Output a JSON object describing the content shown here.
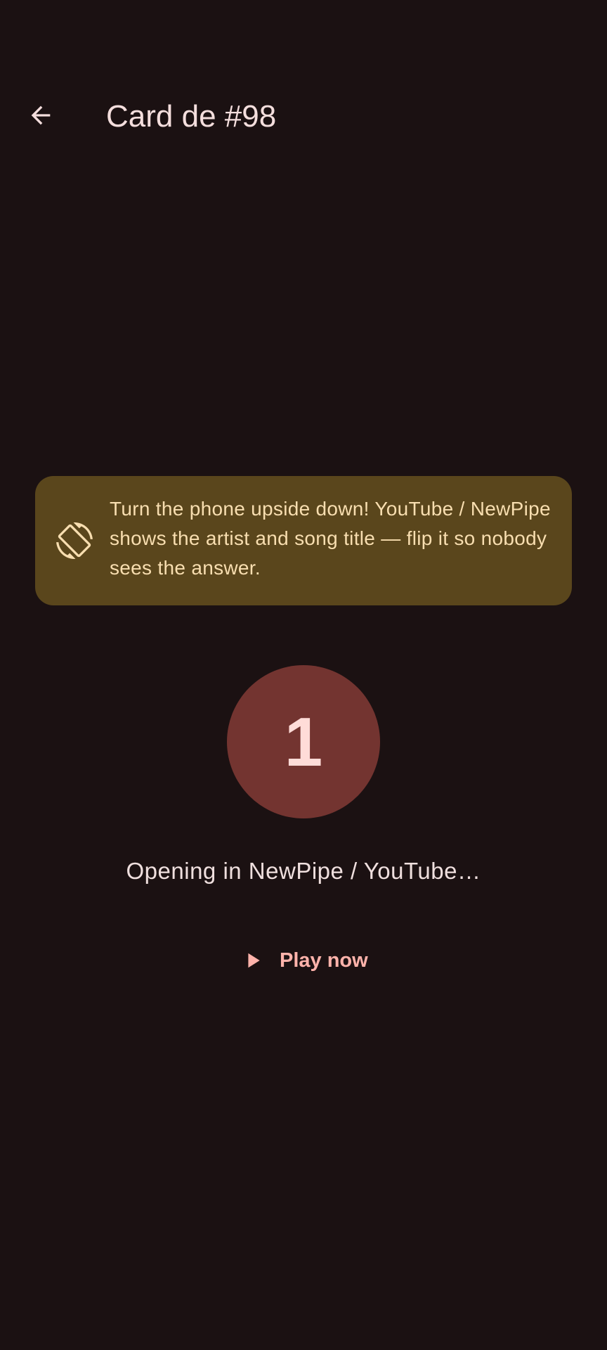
{
  "app_bar": {
    "title": "Card de #98",
    "back_icon": "arrow-back-icon"
  },
  "tip_card": {
    "icon": "screen-rotation-icon",
    "text": "Turn the phone upside down! YouTube / NewPipe shows the artist and song title — flip it so nobody sees the answer."
  },
  "countdown": {
    "value": "1"
  },
  "status": {
    "text": "Opening in NewPipe / YouTube…"
  },
  "play_button": {
    "icon": "play-icon",
    "label": "Play now"
  },
  "colors": {
    "background": "#1b1112",
    "tip_card_bg": "#5a461c",
    "tip_card_text": "#f8deb0",
    "countdown_bg": "#733430",
    "accent": "#ffb3ab"
  }
}
